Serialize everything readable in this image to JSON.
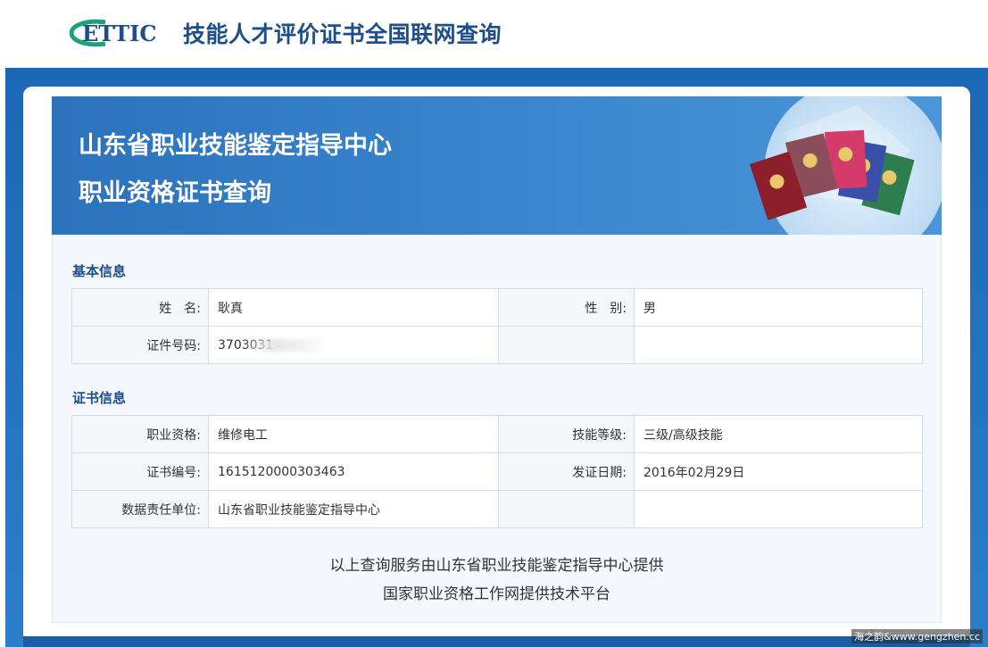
{
  "header": {
    "logo_text": "ETTIC",
    "site_title": "技能人才评价证书全国联网查询"
  },
  "banner": {
    "line1": "山东省职业技能鉴定指导中心",
    "line2": "职业资格证书查询"
  },
  "basic_info": {
    "section_title": "基本信息",
    "name_label": "姓　名:",
    "name_value": "耿真",
    "gender_label": "性　别:",
    "gender_value": "男",
    "id_label": "证件号码:",
    "id_value": "3703031"
  },
  "cert_info": {
    "section_title": "证书信息",
    "qualification_label": "职业资格:",
    "qualification_value": "维修电工",
    "level_label": "技能等级:",
    "level_value": "三级/高级技能",
    "cert_no_label": "证书编号:",
    "cert_no_value": "1615120000303463",
    "issue_date_label": "发证日期:",
    "issue_date_value": "2016年02月29日",
    "unit_label": "数据责任单位:",
    "unit_value": "山东省职业技能鉴定指导中心"
  },
  "footer": {
    "line1": "以上查询服务由山东省职业技能鉴定指导中心提供",
    "line2": "国家职业资格工作网提供技术平台"
  },
  "watermark": "海之韵&www.gengzhen.cc",
  "colors": {
    "brand": "#1d4e89",
    "frame": "#1a67b6",
    "logo_green": "#1aa37a"
  }
}
